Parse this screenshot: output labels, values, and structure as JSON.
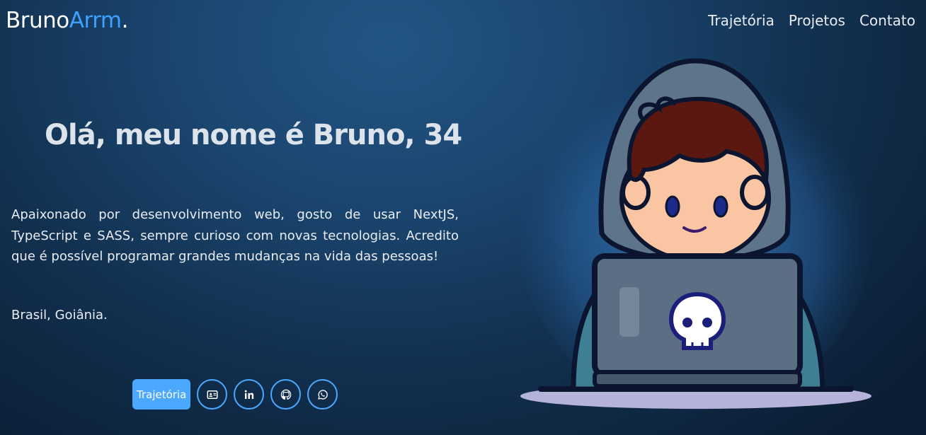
{
  "header": {
    "logo_main": "Bruno",
    "logo_accent": "Arrm",
    "logo_dot": ".",
    "nav": [
      "Trajetória",
      "Projetos",
      "Contato"
    ]
  },
  "hero": {
    "title": "Olá, meu nome é Bruno, 34",
    "bio": "Apaixonado por desenvolvimento web, gosto de usar NextJS, TypeScript e SASS, sempre curioso com novas tecnologias. Acredito que é possível programar grandes mudanças na vida das pessoas!",
    "location": "Brasil, Goiânia."
  },
  "actions": {
    "primary_label": "Trajetória",
    "icons": [
      "id-card-icon",
      "linkedin-icon",
      "github-icon",
      "whatsapp-icon"
    ]
  },
  "colors": {
    "accent": "#3ea1ff",
    "button": "#4aa8ff",
    "background_center": "#235583",
    "background_edge": "#0b1d33"
  }
}
